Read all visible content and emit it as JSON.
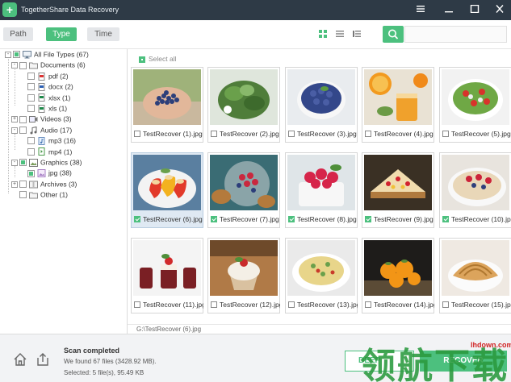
{
  "window": {
    "title": "TogetherShare Data Recovery",
    "controls": [
      "menu-icon",
      "minimize-icon",
      "maximize-icon",
      "close-icon"
    ]
  },
  "toolbar": {
    "tabs": [
      {
        "label": "Path",
        "active": false
      },
      {
        "label": "Type",
        "active": true
      },
      {
        "label": "Time",
        "active": false
      }
    ],
    "views": [
      "grid-view-icon",
      "list-view-icon",
      "detail-view-icon"
    ],
    "search": {
      "placeholder": "",
      "value": ""
    }
  },
  "tree": {
    "items": [
      {
        "label": "All File Types (67)",
        "level": 0,
        "expander": "-",
        "check": "partial",
        "icon": "monitor-icon"
      },
      {
        "label": "Documents (6)",
        "level": 1,
        "expander": "-",
        "check": "none",
        "icon": "folder-icon"
      },
      {
        "label": "pdf (2)",
        "level": 2,
        "expander": "",
        "check": "none",
        "icon": "pdf-file-icon"
      },
      {
        "label": "docx (2)",
        "level": 2,
        "expander": "",
        "check": "none",
        "icon": "word-file-icon"
      },
      {
        "label": "xlsx (1)",
        "level": 2,
        "expander": "",
        "check": "none",
        "icon": "excel-file-icon"
      },
      {
        "label": "xls (1)",
        "level": 2,
        "expander": "",
        "check": "none",
        "icon": "excel-file-icon"
      },
      {
        "label": "Videos (3)",
        "level": 1,
        "expander": "+",
        "check": "none",
        "icon": "video-icon"
      },
      {
        "label": "Audio (17)",
        "level": 1,
        "expander": "-",
        "check": "none",
        "icon": "music-note-icon"
      },
      {
        "label": "mp3 (16)",
        "level": 2,
        "expander": "",
        "check": "none",
        "icon": "audio-file-icon"
      },
      {
        "label": "mp4 (1)",
        "level": 2,
        "expander": "",
        "check": "none",
        "icon": "video-file-icon"
      },
      {
        "label": "Graphics (38)",
        "level": 1,
        "expander": "-",
        "check": "partial",
        "icon": "image-icon"
      },
      {
        "label": "jpg (38)",
        "level": 2,
        "expander": "",
        "check": "partial",
        "icon": "jpg-file-icon"
      },
      {
        "label": "Archives (3)",
        "level": 1,
        "expander": "+",
        "check": "none",
        "icon": "archive-icon"
      },
      {
        "label": "Other (1)",
        "level": 1,
        "expander": "",
        "check": "none",
        "icon": "folder-icon"
      }
    ]
  },
  "content": {
    "select_all_label": "Select all",
    "files": [
      {
        "name": "TestRecover (1).jpg",
        "checked": false,
        "selected": false,
        "image": "hands-blueberries"
      },
      {
        "name": "TestRecover (2).jpg",
        "checked": false,
        "selected": false,
        "image": "herbs-greens"
      },
      {
        "name": "TestRecover (3).jpg",
        "checked": false,
        "selected": false,
        "image": "blueberries-bowl"
      },
      {
        "name": "TestRecover (4).jpg",
        "checked": false,
        "selected": false,
        "image": "orange-juice"
      },
      {
        "name": "TestRecover (5).jpg",
        "checked": false,
        "selected": false,
        "image": "green-salad"
      },
      {
        "name": "TestRecover (6).jpg",
        "checked": true,
        "selected": true,
        "image": "stuffed-peppers"
      },
      {
        "name": "TestRecover (7).jpg",
        "checked": true,
        "selected": false,
        "image": "berries-muffins"
      },
      {
        "name": "TestRecover (8).jpg",
        "checked": true,
        "selected": false,
        "image": "raspberries-bowl"
      },
      {
        "name": "TestRecover (9).jpg",
        "checked": true,
        "selected": false,
        "image": "cheesecake"
      },
      {
        "name": "TestRecover (10).jpg",
        "checked": true,
        "selected": false,
        "image": "oatmeal-berries"
      },
      {
        "name": "TestRecover (11).jpg",
        "checked": false,
        "selected": false,
        "image": "dessert-cups"
      },
      {
        "name": "TestRecover (12).jpg",
        "checked": false,
        "selected": false,
        "image": "ice-cream-cup"
      },
      {
        "name": "TestRecover (13).jpg",
        "checked": false,
        "selected": false,
        "image": "pasta-salad"
      },
      {
        "name": "TestRecover (14).jpg",
        "checked": false,
        "selected": false,
        "image": "orange-tomatoes"
      },
      {
        "name": "TestRecover (15).jpg",
        "checked": false,
        "selected": false,
        "image": "pastry"
      }
    ],
    "current_path": "G:\\TestRecover (6).jpg"
  },
  "footer": {
    "scan_title": "Scan completed",
    "scan_info": "We found 67 files (3428.92 MB).",
    "selected_info": "Selected: 5 file(s), 95.49 KB",
    "deep_scan_label": "DEEP",
    "recover_label": "RECOVER"
  },
  "watermark": {
    "text": "领航下载",
    "url": "lhdown.com"
  },
  "colors": {
    "accent": "#4cc07e",
    "titlebar": "#2e3a46",
    "selected_card": "#dfe9f3"
  }
}
